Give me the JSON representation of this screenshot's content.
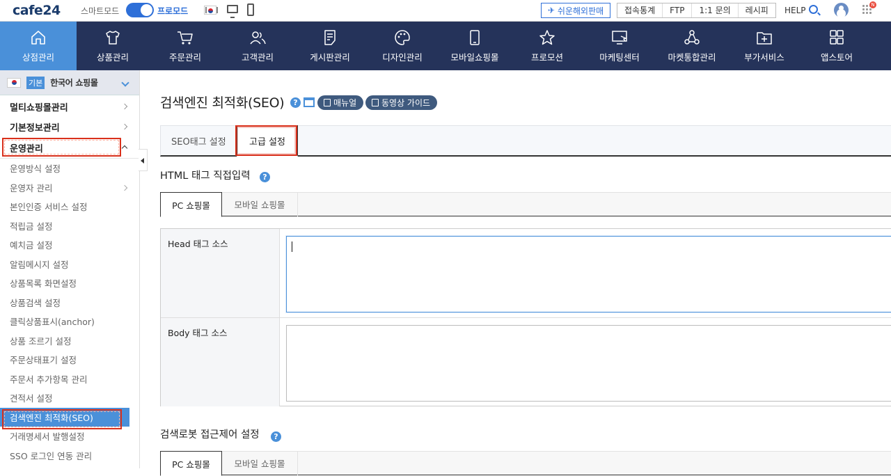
{
  "topbar": {
    "logo": "cafe24",
    "mode_label": "스마트모드",
    "pro_label": "프로모드",
    "global_btn": "쉬운해외판매",
    "links": [
      "접속통계",
      "FTP",
      "1:1 문의",
      "레시피"
    ],
    "help": "HELP",
    "apps_badge": "N"
  },
  "mainnav": {
    "items": [
      {
        "label": "상점관리",
        "icon": "home-icon"
      },
      {
        "label": "상품관리",
        "icon": "shirt-icon"
      },
      {
        "label": "주문관리",
        "icon": "cart-icon"
      },
      {
        "label": "고객관리",
        "icon": "users-icon"
      },
      {
        "label": "게시판관리",
        "icon": "board-icon"
      },
      {
        "label": "디자인관리",
        "icon": "palette-icon"
      },
      {
        "label": "모바일쇼핑몰",
        "icon": "mobile-icon"
      },
      {
        "label": "프로모션",
        "icon": "star-icon"
      },
      {
        "label": "마케팅센터",
        "icon": "monitor-cursor-icon"
      },
      {
        "label": "마켓통합관리",
        "icon": "network-icon"
      },
      {
        "label": "부가서비스",
        "icon": "folder-plus-icon"
      },
      {
        "label": "앱스토어",
        "icon": "apps-grid-icon"
      }
    ]
  },
  "sidebar": {
    "shop_badge": "기본",
    "shop_name": "한국어 쇼핑몰",
    "sections": [
      "멀티쇼핑몰관리",
      "기본정보관리",
      "운영관리"
    ],
    "items": [
      "운영방식 설정",
      "운영자 관리",
      "본인인증 서비스 설정",
      "적립금 설정",
      "예치금 설정",
      "알림메시지 설정",
      "상품목록 화면설정",
      "상품검색 설정",
      "클릭상품표시(anchor)",
      "상품 조르기 설정",
      "주문상태표기 설정",
      "주문서 추가항목 관리",
      "견적서 설정",
      "검색엔진 최적화(SEO)",
      "거래명세서 발행설정",
      "SSO 로그인 연동 관리"
    ]
  },
  "content": {
    "title": "검색엔진 최적화(SEO)",
    "manual_btn": "매뉴얼",
    "video_btn": "동영상 가이드",
    "tabs": [
      "SEO태그 설정",
      "고급 설정"
    ],
    "section1_title": "HTML 태그 직접입력",
    "section2_title": "검색로봇 접근제어 설정",
    "subtabs": [
      "PC 쇼핑몰",
      "모바일 쇼핑몰"
    ],
    "head_label": "Head 태그 소스",
    "body_label": "Body 태그 소스",
    "help_mark": "?"
  },
  "colors": {
    "nav_bg": "#25335a",
    "accent": "#4a90d9",
    "highlight": "#d9301b"
  }
}
